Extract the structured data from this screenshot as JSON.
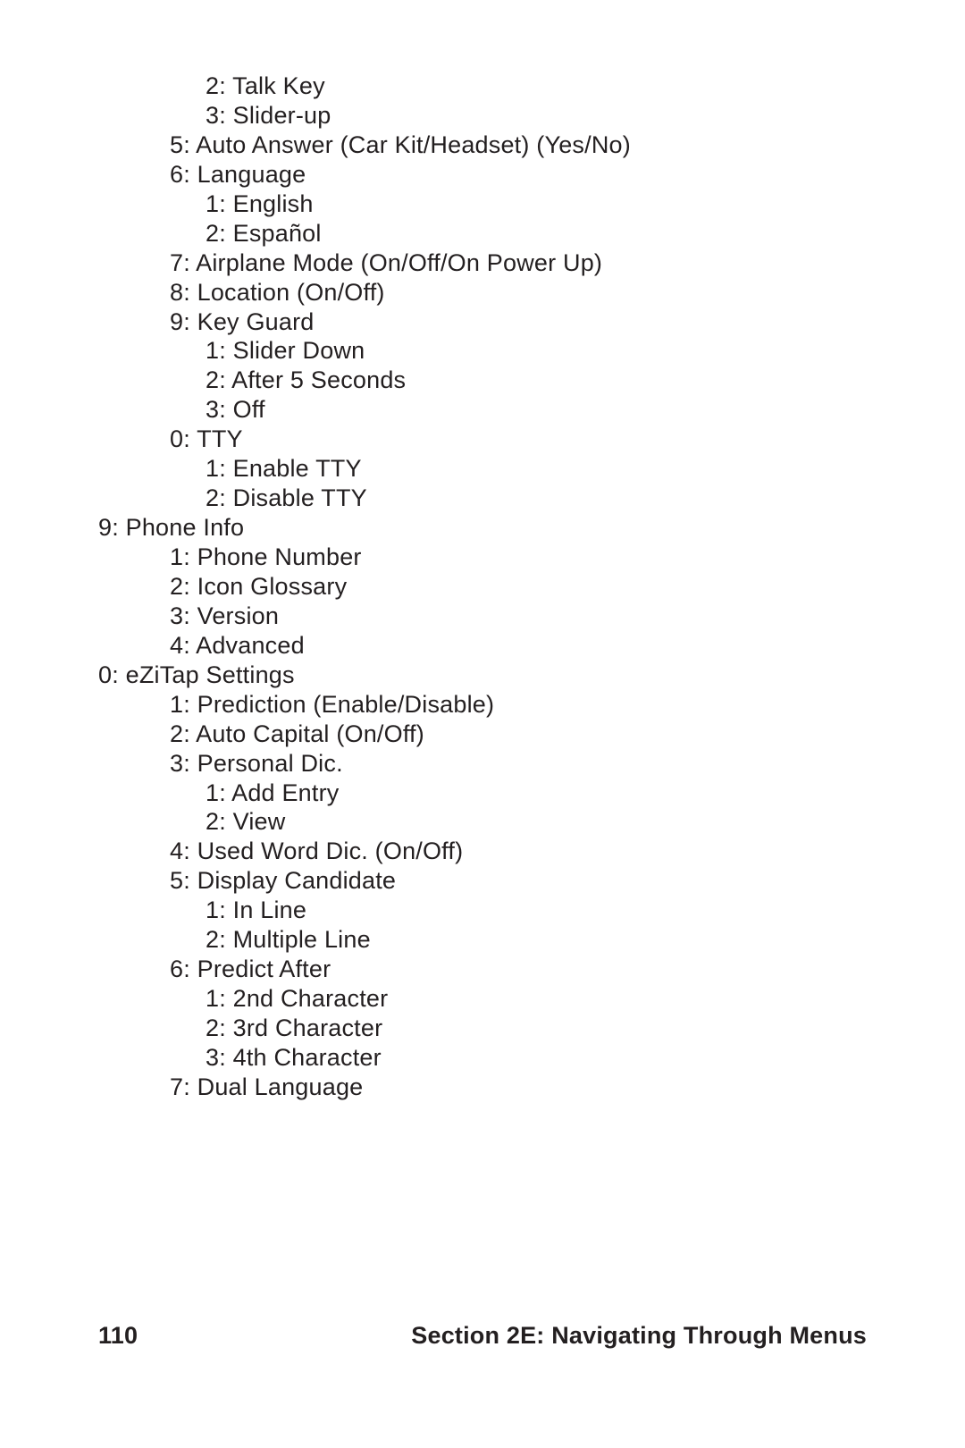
{
  "lines": [
    {
      "indent": 3,
      "text": "2: Talk Key"
    },
    {
      "indent": 3,
      "text": "3: Slider-up"
    },
    {
      "indent": 2,
      "text": "5: Auto Answer (Car Kit/Headset) (Yes/No)"
    },
    {
      "indent": 2,
      "text": "6: Language"
    },
    {
      "indent": 3,
      "text": "1: English"
    },
    {
      "indent": 3,
      "text": "2: Español"
    },
    {
      "indent": 2,
      "text": "7: Airplane Mode (On/Off/On Power Up)"
    },
    {
      "indent": 2,
      "text": "8: Location (On/Off)"
    },
    {
      "indent": 2,
      "text": "9: Key Guard"
    },
    {
      "indent": 3,
      "text": "1: Slider Down"
    },
    {
      "indent": 3,
      "text": "2: After 5 Seconds"
    },
    {
      "indent": 3,
      "text": "3: Off"
    },
    {
      "indent": 2,
      "text": "0: TTY"
    },
    {
      "indent": 3,
      "text": "1: Enable TTY"
    },
    {
      "indent": 3,
      "text": "2: Disable TTY"
    },
    {
      "indent": 0,
      "text": "9: Phone Info"
    },
    {
      "indent": 2,
      "text": "1: Phone Number"
    },
    {
      "indent": 2,
      "text": "2: Icon Glossary"
    },
    {
      "indent": 2,
      "text": "3: Version"
    },
    {
      "indent": 2,
      "text": "4: Advanced"
    },
    {
      "indent": 0,
      "text": "0: eZiTap Settings"
    },
    {
      "indent": 2,
      "text": "1: Prediction (Enable/Disable)"
    },
    {
      "indent": 2,
      "text": "2: Auto Capital (On/Off)"
    },
    {
      "indent": 2,
      "text": "3: Personal Dic."
    },
    {
      "indent": 3,
      "text": "1: Add Entry"
    },
    {
      "indent": 3,
      "text": "2: View"
    },
    {
      "indent": 2,
      "text": "4: Used Word Dic. (On/Off)"
    },
    {
      "indent": 2,
      "text": "5: Display Candidate"
    },
    {
      "indent": 3,
      "text": "1: In Line"
    },
    {
      "indent": 3,
      "text": "2: Multiple Line"
    },
    {
      "indent": 2,
      "text": "6: Predict After"
    },
    {
      "indent": 3,
      "text": "1: 2nd Character"
    },
    {
      "indent": 3,
      "text": "2: 3rd Character"
    },
    {
      "indent": 3,
      "text": "3: 4th Character"
    },
    {
      "indent": 2,
      "text": "7: Dual Language"
    }
  ],
  "footer": {
    "page_number": "110",
    "section_title": "Section 2E: Navigating Through Menus"
  }
}
